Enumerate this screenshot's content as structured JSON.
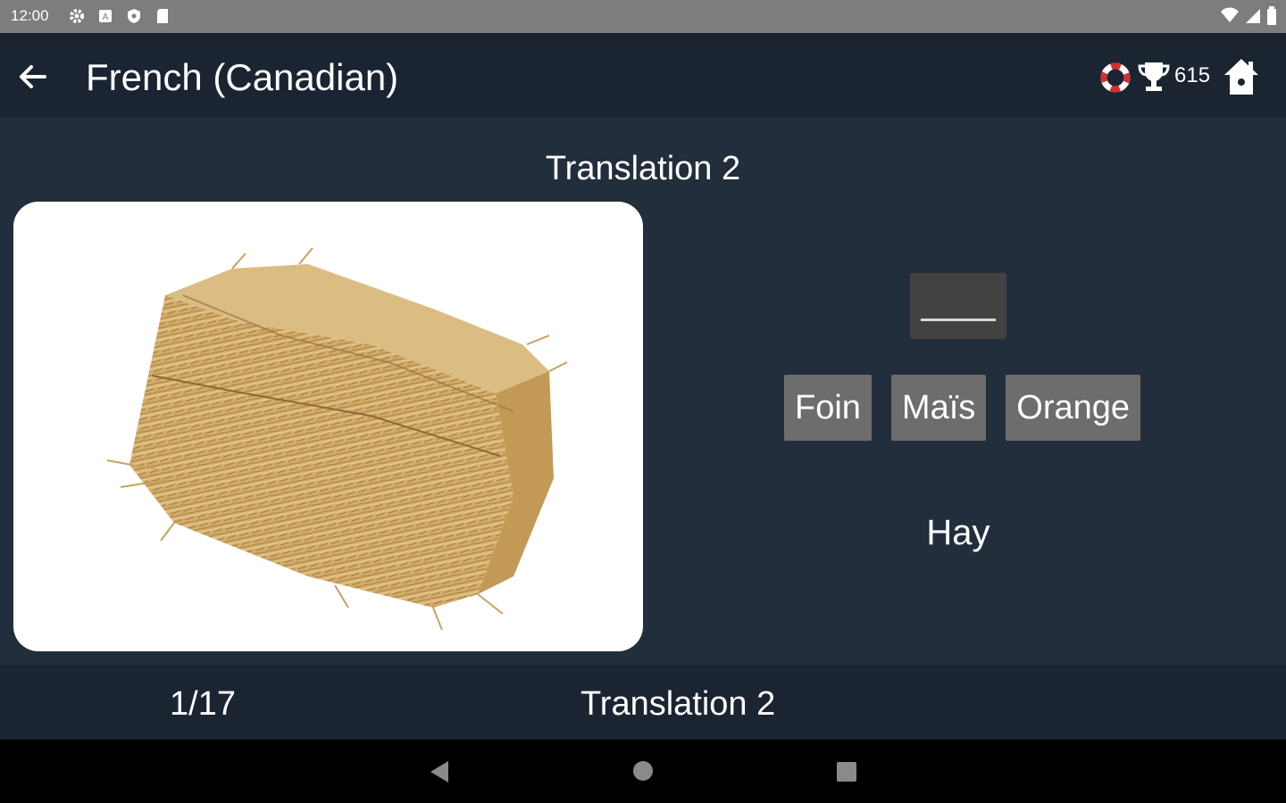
{
  "status_bar": {
    "time": "12:00"
  },
  "app_bar": {
    "title": "French (Canadian)",
    "score": "615"
  },
  "main": {
    "lesson_title": "Translation 2",
    "image_subject": "hay-bale",
    "answer_blank": "",
    "options": [
      "Foin",
      "Maïs",
      "Orange"
    ],
    "english_word": "Hay"
  },
  "bottom_bar": {
    "progress": "1/17",
    "title": "Translation 2"
  },
  "colors": {
    "background": "#232e3c",
    "bars": "#1b2431",
    "option_button": "#6d6d6d",
    "answer_slot": "#424242",
    "status_bar": "#7d7d7d",
    "lifebuoy": "#d32f2f"
  }
}
